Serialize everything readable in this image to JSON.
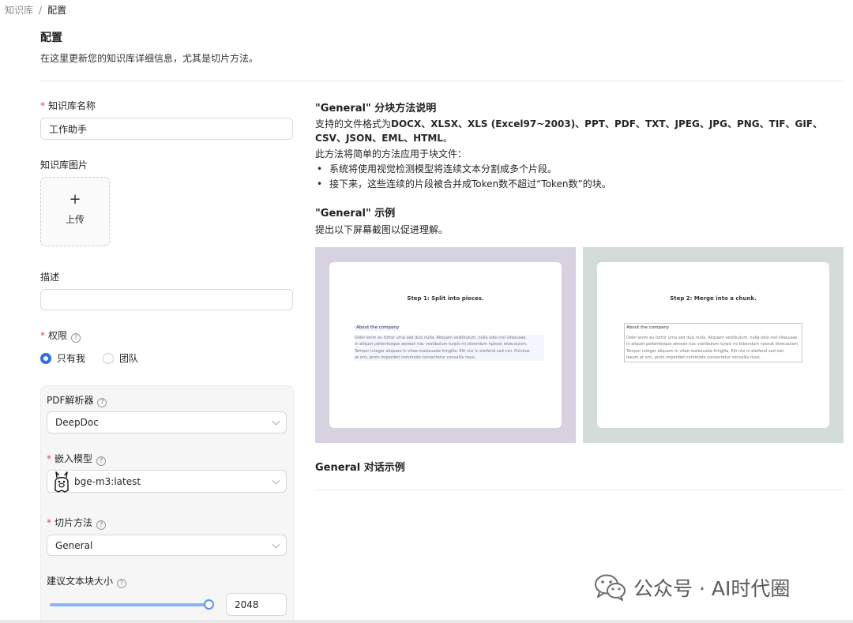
{
  "breadcrumb": {
    "root": "知识库",
    "separator": "/",
    "current": "配置"
  },
  "header": {
    "title": "配置",
    "subtitle": "在这里更新您的知识库详细信息，尤其是切片方法。"
  },
  "form": {
    "kb_name": {
      "label": "知识库名称",
      "required": "*",
      "value": "工作助手"
    },
    "kb_image": {
      "label": "知识库图片",
      "plus": "+",
      "upload_label": "上传"
    },
    "description": {
      "label": "描述",
      "value": ""
    },
    "permission": {
      "label": "权限",
      "required": "*",
      "options": [
        "只有我",
        "团队"
      ],
      "selected": "只有我"
    },
    "pdf_parser": {
      "label": "PDF解析器",
      "value": "DeepDoc"
    },
    "embedding_model": {
      "label": "嵌入模型",
      "required": "*",
      "value": "bge-m3:latest"
    },
    "chunk_method": {
      "label": "切片方法",
      "required": "*",
      "value": "General"
    },
    "chunk_size": {
      "label": "建议文本块大小",
      "value": "2048",
      "slider_fraction": 1.0
    }
  },
  "help_glyph": "?",
  "guide": {
    "method_title": "\"General\" 分块方法说明",
    "formats_prefix": "支持的文件格式为",
    "formats": "DOCX、XLSX、XLS (Excel97~2003)、PPT、PDF、TXT、JPEG、JPG、PNG、TIF、GIF、CSV、JSON、EML、HTML",
    "formats_suffix": "。",
    "method_intro": "此方法将简单的方法应用于块文件：",
    "bullets": [
      "系统将使用视觉检测模型将连续文本分割成多个片段。",
      "接下来，这些连续的片段被合并成Token数不超过“Token数”的块。"
    ],
    "example_title": "\"General\" 示例",
    "example_desc": "提出以下屏幕截图以促进理解。",
    "image1": {
      "step": "Step 1: Split into pieces.",
      "chunk_title": "About the company",
      "lines": [
        "Dolor enim eu tortor urna sed duis nulla. Aliquam vestibulum, nulla odio nisl vitasusae.",
        "In aliquet pellentesque aenean hac vestibulum turpis mi bibendum npexat divecauism.",
        "Tempor integer aliquam in vitae malesuada fringilla. Elit nisi in eleifend sed nisi. Pulvinar",
        "at orci, proin imperdiet commodo consectetur convallis risus."
      ],
      "bg_color": "#d6d2e0"
    },
    "image2": {
      "step": "Step 2: Merge into a chunk.",
      "chunk_title": "About the company",
      "lines": [
        "Dolor enim eu tortor urna sed duis nulla. Aliquam vestibulum, nulla odio nisl vitasusae.",
        "In aliquet pellentesque aenean hac vestibulum turpis mi bibendum npexat divecauism.",
        "Tempor integer aliquam in vitae malesuada fringilla. Elit nisi in eleifend sed nisi.",
        "Ipsum at orci, proin imperdiet commodo consectetur convallis risus."
      ],
      "bg_color": "#d3dcd8"
    },
    "dialog_title": "General 对话示例"
  },
  "watermark": {
    "text": "公众号 · AI时代圈",
    "icon": "wechat-icon"
  },
  "colors": {
    "primary": "#2f6fed",
    "required": "#e5484d"
  }
}
